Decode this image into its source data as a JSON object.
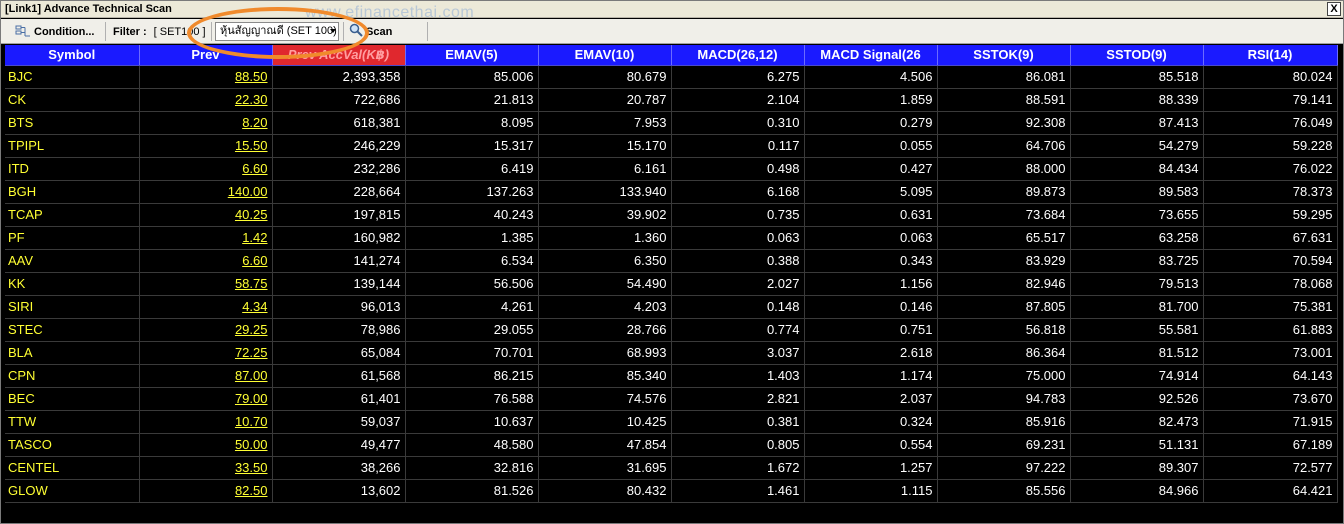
{
  "window": {
    "title": "[Link1] Advance Technical Scan",
    "close_label": "X"
  },
  "watermark": "www.efinancethai.com",
  "toolbar": {
    "condition_label": "Condition...",
    "filter_label": "Filter :",
    "filter_value": "[ SET100 ]",
    "dropdown_value": "หุ้นสัญญาณดี (SET 100)",
    "scan_label": "Scan"
  },
  "columns": [
    "Symbol",
    "Prev",
    "Prev AccVal(K฿)",
    "EMAV(5)",
    "EMAV(10)",
    "MACD(26,12)",
    "MACD Signal(26",
    "SSTOK(9)",
    "SSTOD(9)",
    "RSI(14)"
  ],
  "rows": [
    [
      "BJC",
      "88.50",
      "2,393,358",
      "85.006",
      "80.679",
      "6.275",
      "4.506",
      "86.081",
      "85.518",
      "80.024"
    ],
    [
      "CK",
      "22.30",
      "722,686",
      "21.813",
      "20.787",
      "2.104",
      "1.859",
      "88.591",
      "88.339",
      "79.141"
    ],
    [
      "BTS",
      "8.20",
      "618,381",
      "8.095",
      "7.953",
      "0.310",
      "0.279",
      "92.308",
      "87.413",
      "76.049"
    ],
    [
      "TPIPL",
      "15.50",
      "246,229",
      "15.317",
      "15.170",
      "0.117",
      "0.055",
      "64.706",
      "54.279",
      "59.228"
    ],
    [
      "ITD",
      "6.60",
      "232,286",
      "6.419",
      "6.161",
      "0.498",
      "0.427",
      "88.000",
      "84.434",
      "76.022"
    ],
    [
      "BGH",
      "140.00",
      "228,664",
      "137.263",
      "133.940",
      "6.168",
      "5.095",
      "89.873",
      "89.583",
      "78.373"
    ],
    [
      "TCAP",
      "40.25",
      "197,815",
      "40.243",
      "39.902",
      "0.735",
      "0.631",
      "73.684",
      "73.655",
      "59.295"
    ],
    [
      "PF",
      "1.42",
      "160,982",
      "1.385",
      "1.360",
      "0.063",
      "0.063",
      "65.517",
      "63.258",
      "67.631"
    ],
    [
      "AAV",
      "6.60",
      "141,274",
      "6.534",
      "6.350",
      "0.388",
      "0.343",
      "83.929",
      "83.725",
      "70.594"
    ],
    [
      "KK",
      "58.75",
      "139,144",
      "56.506",
      "54.490",
      "2.027",
      "1.156",
      "82.946",
      "79.513",
      "78.068"
    ],
    [
      "SIRI",
      "4.34",
      "96,013",
      "4.261",
      "4.203",
      "0.148",
      "0.146",
      "87.805",
      "81.700",
      "75.381"
    ],
    [
      "STEC",
      "29.25",
      "78,986",
      "29.055",
      "28.766",
      "0.774",
      "0.751",
      "56.818",
      "55.581",
      "61.883"
    ],
    [
      "BLA",
      "72.25",
      "65,084",
      "70.701",
      "68.993",
      "3.037",
      "2.618",
      "86.364",
      "81.512",
      "73.001"
    ],
    [
      "CPN",
      "87.00",
      "61,568",
      "86.215",
      "85.340",
      "1.403",
      "1.174",
      "75.000",
      "74.914",
      "64.143"
    ],
    [
      "BEC",
      "79.00",
      "61,401",
      "76.588",
      "74.576",
      "2.821",
      "2.037",
      "94.783",
      "92.526",
      "73.670"
    ],
    [
      "TTW",
      "10.70",
      "59,037",
      "10.637",
      "10.425",
      "0.381",
      "0.324",
      "85.916",
      "82.473",
      "71.915"
    ],
    [
      "TASCO",
      "50.00",
      "49,477",
      "48.580",
      "47.854",
      "0.805",
      "0.554",
      "69.231",
      "51.131",
      "67.189"
    ],
    [
      "CENTEL",
      "33.50",
      "38,266",
      "32.816",
      "31.695",
      "1.672",
      "1.257",
      "97.222",
      "89.307",
      "72.577"
    ],
    [
      "GLOW",
      "82.50",
      "13,602",
      "81.526",
      "80.432",
      "1.461",
      "1.115",
      "85.556",
      "84.966",
      "64.421"
    ]
  ],
  "colors": {
    "header_bg": "#1a1aff",
    "sorted_header_bg": "#e0282e",
    "grid_bg": "#000000",
    "symbol_text": "#ffff33",
    "value_text": "#ffffff",
    "highlight_ring": "#f08a2c"
  },
  "icons": {
    "condition": "condition-icon",
    "scan": "magnifier-icon",
    "dropdown": "chevron-down-icon"
  }
}
